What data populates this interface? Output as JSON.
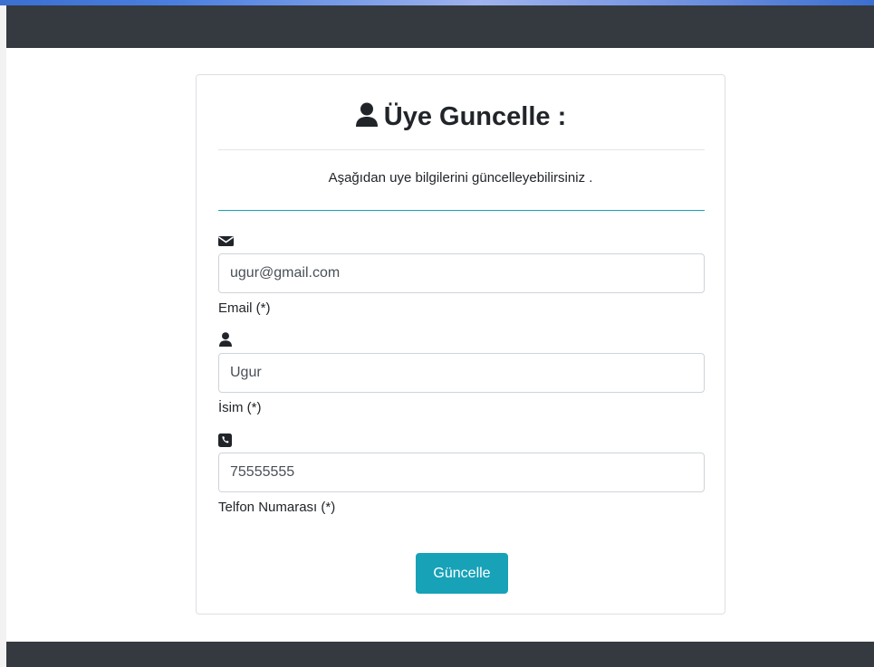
{
  "card": {
    "title": "Üye Guncelle :",
    "title_icon": "user-icon",
    "subtitle": "Aşağıdan uye bilgilerini güncelleyebilirsiniz ."
  },
  "fields": {
    "email": {
      "icon": "envelope-icon",
      "value": "ugur@gmail.com",
      "label": "Email (*)"
    },
    "name": {
      "icon": "user-icon",
      "value": "Ugur",
      "label": "İsim (*)"
    },
    "phone": {
      "icon": "phone-icon",
      "value": "75555555",
      "label": "Telfon Numarası (*)"
    }
  },
  "submit_label": "Güncelle",
  "colors": {
    "navbar": "#343a40",
    "accent": "#17a2b8"
  }
}
